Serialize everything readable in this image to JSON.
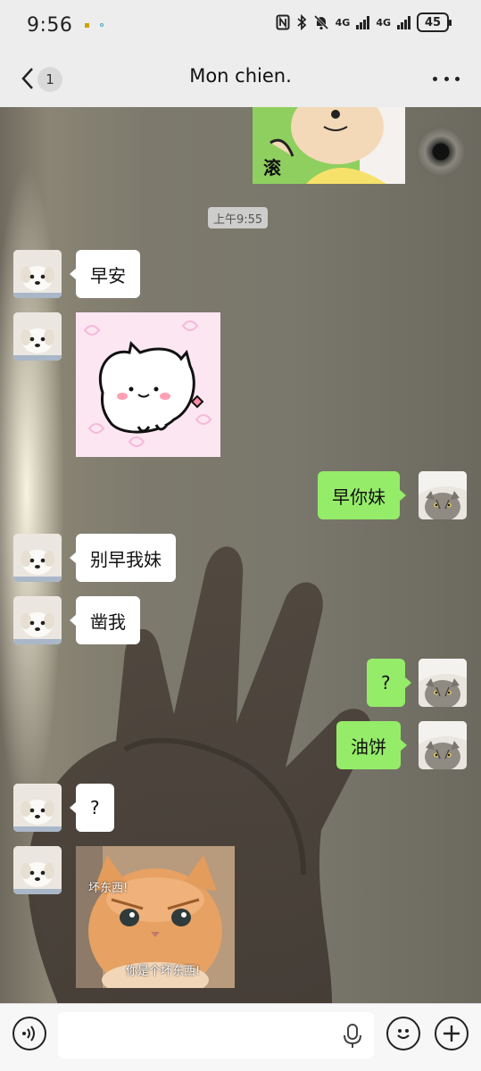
{
  "status_bar": {
    "time": "9:56",
    "network_1": "4G",
    "network_2": "4G",
    "battery": "45"
  },
  "header": {
    "unread_count": "1",
    "title": "Mon chien."
  },
  "chat": {
    "timestamp": "上午9:55",
    "messages": [
      {
        "from": "other",
        "text": "早安"
      },
      {
        "from": "other",
        "sticker": "white-cat-sticker"
      },
      {
        "from": "me",
        "text": "早你妹"
      },
      {
        "from": "other",
        "text": "别早我妹"
      },
      {
        "from": "other",
        "text": "凿我"
      },
      {
        "from": "me",
        "text": "?"
      },
      {
        "from": "me",
        "text": "油饼"
      },
      {
        "from": "other",
        "text": "?"
      },
      {
        "from": "other",
        "sticker": "angry-kitten-sticker"
      }
    ],
    "top_sticker_text": "滚",
    "kitten_sticker_text_1": "坏东西!",
    "kitten_sticker_text_2": "你是个坏东西!"
  },
  "input": {
    "placeholder": ""
  },
  "colors": {
    "outgoing_bubble": "#95ec69",
    "incoming_bubble": "#ffffff",
    "bar_background": "#ededed"
  }
}
